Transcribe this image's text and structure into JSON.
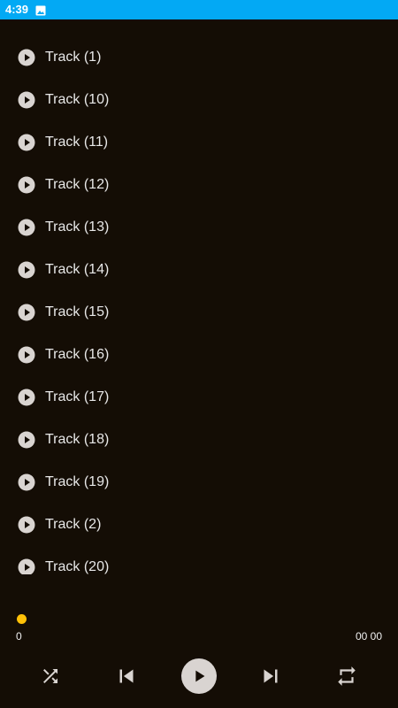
{
  "status_bar": {
    "time": "4:39",
    "icons": [
      "image-icon"
    ],
    "color": "#03a9f4"
  },
  "tracks": [
    {
      "label": "Track (1)"
    },
    {
      "label": "Track (10)"
    },
    {
      "label": "Track (11)"
    },
    {
      "label": "Track (12)"
    },
    {
      "label": "Track (13)"
    },
    {
      "label": "Track (14)"
    },
    {
      "label": "Track (15)"
    },
    {
      "label": "Track (16)"
    },
    {
      "label": "Track (17)"
    },
    {
      "label": "Track (18)"
    },
    {
      "label": "Track (19)"
    },
    {
      "label": "Track (2)"
    },
    {
      "label": "Track (20)"
    }
  ],
  "player": {
    "current_time": "0",
    "total_time": "00 00",
    "progress": 0,
    "seek_color": "#ffc107",
    "controls": [
      "shuffle-icon",
      "previous-icon",
      "play-icon",
      "next-icon",
      "repeat-icon"
    ]
  },
  "colors": {
    "background": "#140d05",
    "text": "#e8e8e8",
    "icon": "#d9d4d1"
  }
}
